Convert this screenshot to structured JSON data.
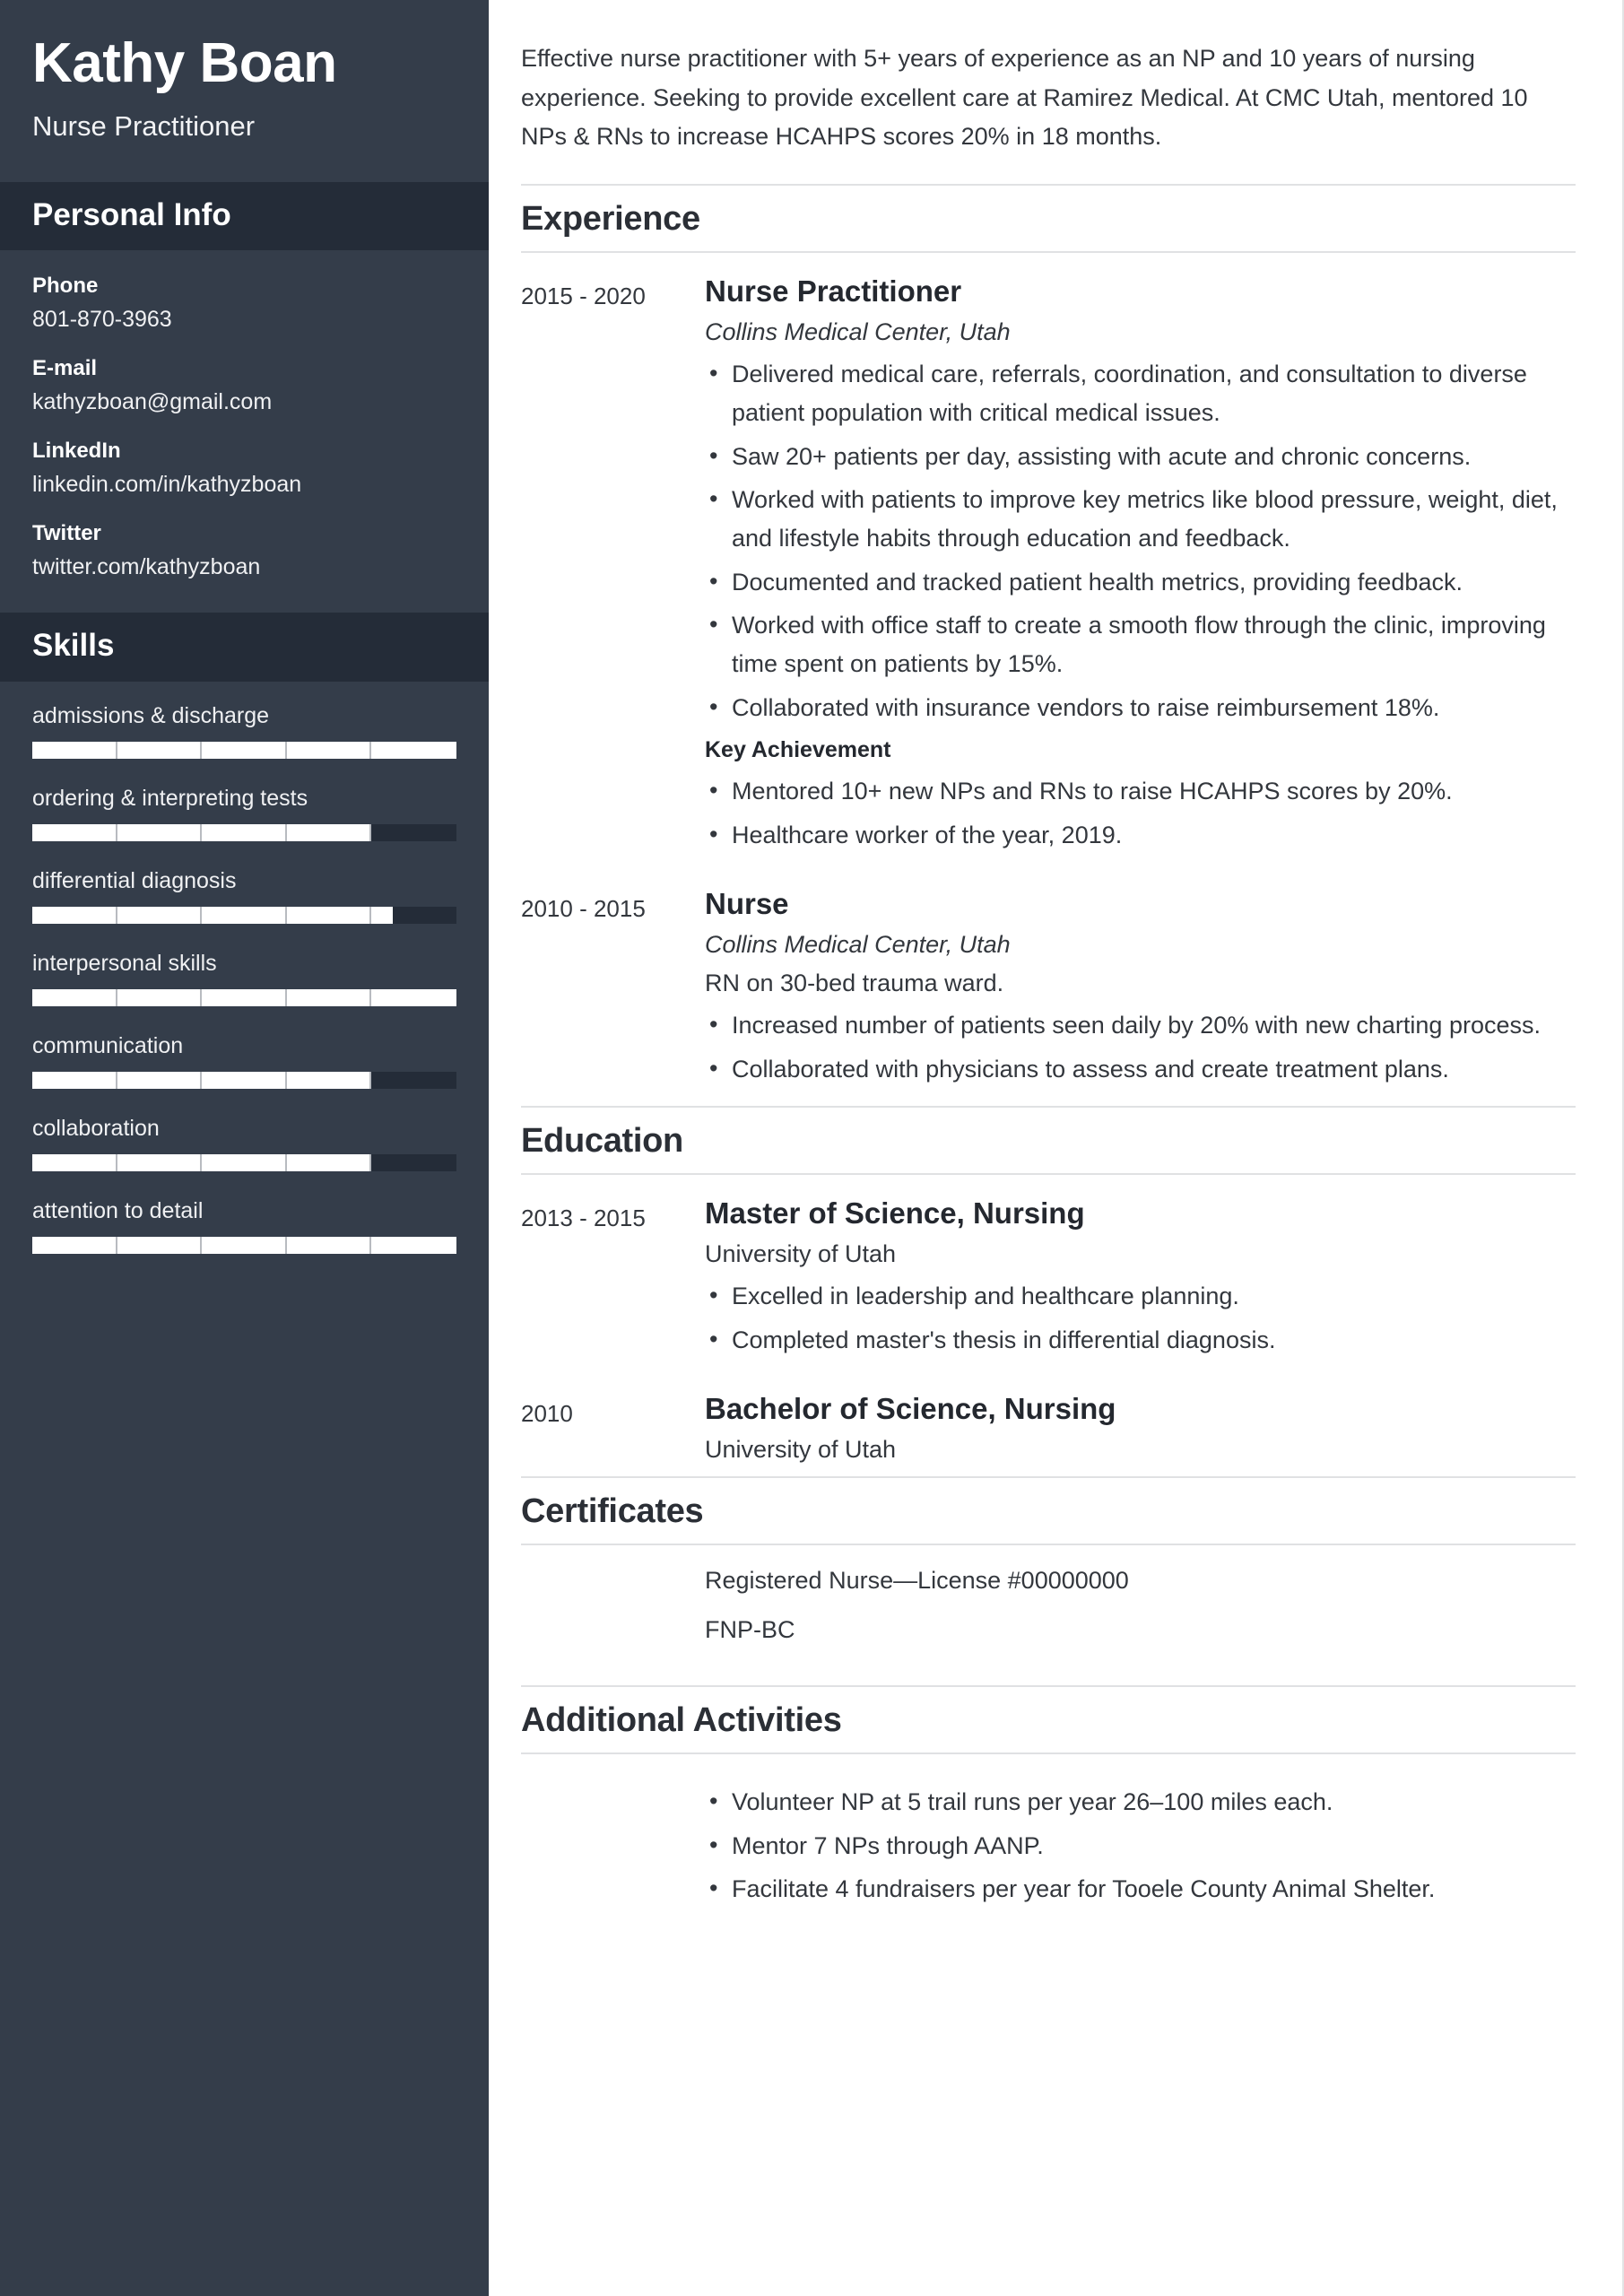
{
  "sidebar": {
    "name": "Kathy Boan",
    "job_title": "Nurse Practitioner",
    "personal_info_heading": "Personal Info",
    "contacts": [
      {
        "label": "Phone",
        "value": "801-870-3963"
      },
      {
        "label": "E-mail",
        "value": "kathyzboan@gmail.com"
      },
      {
        "label": "LinkedIn",
        "value": "linkedin.com/in/kathyzboan"
      },
      {
        "label": "Twitter",
        "value": "twitter.com/kathyzboan"
      }
    ],
    "skills_heading": "Skills",
    "skills": [
      {
        "name": "admissions & discharge",
        "level": 100
      },
      {
        "name": "ordering & interpreting tests",
        "level": 80
      },
      {
        "name": "differential diagnosis",
        "level": 85
      },
      {
        "name": "interpersonal skills",
        "level": 100
      },
      {
        "name": "communication",
        "level": 80
      },
      {
        "name": "collaboration",
        "level": 80
      },
      {
        "name": "attention to detail",
        "level": 100
      }
    ],
    "colors": {
      "sidebar_bg": "#343d4a",
      "section_bar_bg": "#242c38",
      "bar_fill": "#ffffff",
      "bar_track": "#242c38"
    }
  },
  "main": {
    "summary": "Effective nurse practitioner with 5+ years of experience as an NP and 10 years of nursing experience. Seeking to provide excellent care at Ramirez Medical. At CMC Utah, mentored 10 NPs & RNs to increase HCAHPS scores 20% in 18 months.",
    "experience": {
      "heading": "Experience",
      "entries": [
        {
          "dates": "2015 - 2020",
          "role": "Nurse Practitioner",
          "org": "Collins Medical Center, Utah",
          "bullets": [
            "Delivered medical care, referrals, coordination, and consultation to diverse patient population with critical medical issues.",
            "Saw 20+ patients per day, assisting with acute and chronic concerns.",
            "Worked with patients to improve key metrics like blood pressure, weight, diet, and lifestyle habits through education and feedback.",
            "Documented and tracked patient health metrics, providing feedback.",
            "Worked with office staff to create a smooth flow through the clinic, improving time spent on patients by 15%.",
            "Collaborated with insurance vendors to raise reimbursement 18%."
          ],
          "achievement_label": "Key Achievement",
          "achievements": [
            "Mentored 10+ new NPs and RNs to raise HCAHPS scores by 20%.",
            "Healthcare worker of the year, 2019."
          ]
        },
        {
          "dates": "2010 - 2015",
          "role": "Nurse",
          "org": "Collins Medical Center, Utah",
          "note": "RN on 30-bed trauma ward.",
          "bullets": [
            "Increased number of patients seen daily by 20% with new charting process.",
            "Collaborated with physicians to assess and create treatment plans."
          ]
        }
      ]
    },
    "education": {
      "heading": "Education",
      "entries": [
        {
          "dates": "2013 - 2015",
          "degree": "Master of Science, Nursing",
          "school": "University of Utah",
          "bullets": [
            "Excelled in leadership and healthcare planning.",
            "Completed master's thesis in differential diagnosis."
          ]
        },
        {
          "dates": "2010",
          "degree": "Bachelor of Science, Nursing",
          "school": "University of Utah",
          "bullets": []
        }
      ]
    },
    "certificates": {
      "heading": "Certificates",
      "items": [
        "Registered Nurse—License #00000000",
        "FNP-BC"
      ]
    },
    "activities": {
      "heading": "Additional Activities",
      "items": [
        "Volunteer NP at 5 trail runs per year 26–100 miles each.",
        "Mentor 7 NPs through AANP.",
        "Facilitate 4 fundraisers per year for Tooele County Animal Shelter."
      ]
    }
  }
}
